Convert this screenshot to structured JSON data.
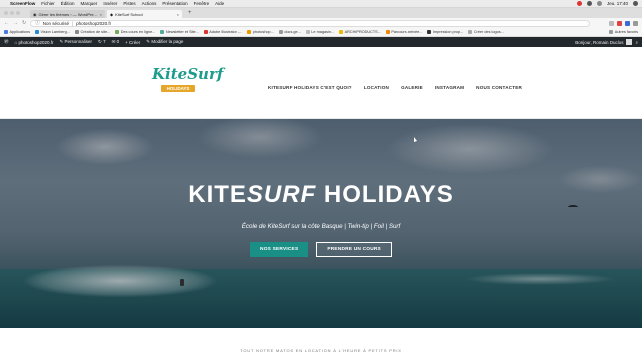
{
  "macos_menubar": {
    "app_name": "ScreenFlow",
    "items": [
      "Fichier",
      "Édition",
      "Marquer",
      "Insérer",
      "Pistes",
      "Actions",
      "Présentation",
      "Fenêtre",
      "Aide"
    ],
    "clock": "Jeu. 17:40"
  },
  "browser": {
    "tabs": [
      {
        "label": "Gérer les thèmes ‹ — WordPre...",
        "active": false
      },
      {
        "label": "KiteSurf School",
        "active": true
      }
    ],
    "address": {
      "security": "Non sécurisé",
      "url": "photoshop2020.fr"
    },
    "bookmarks": [
      "Applications",
      "Vision Lamberg...",
      "Création de site...",
      "Des cours en ligne...",
      "Newsletter et Site...",
      "Adobe Illustrator -...",
      "photoshop...",
      "docs.ge...",
      "Le magasin...",
      "ARCHIPRODUCTS...",
      "Parcours arrivée...",
      "Impression prop...",
      "Créer des logos..."
    ],
    "bookmarks_right": "Autres favoris"
  },
  "wp_admin_bar": {
    "site": "photoshop2020.fr",
    "customize": "Personnaliser",
    "comments": "7",
    "new": "0",
    "create": "Créer",
    "edit_page": "Modifier la page",
    "greeting": "Bonjour, Romain Duclos"
  },
  "site": {
    "logo_script": "KiteSurf",
    "logo_sub": "HOLIDAYS",
    "nav": [
      "KITESURF HOLIDAYS C'EST QUOI?",
      "LOCATION",
      "GALERIE",
      "INSTAGRAM",
      "NOUS CONTACTER"
    ],
    "hero": {
      "title_part1": "KITE",
      "title_part2": "SURF",
      "title_part3": " HOLIDAYS",
      "subtitle": "École de KiteSurf sur la côte Basque | Twin-tip | Foil | Surf",
      "button_primary": "NOS SERVICES",
      "button_secondary": "PRENDRE UN COURS"
    },
    "tagline": "TOUT NOTRE MATOS EN LOCATION À L'HEURE À PETITS PRIX"
  },
  "colors": {
    "teal": "#1a8f86",
    "logo_orange": "#e6a629",
    "wp_bar": "#23282d"
  }
}
